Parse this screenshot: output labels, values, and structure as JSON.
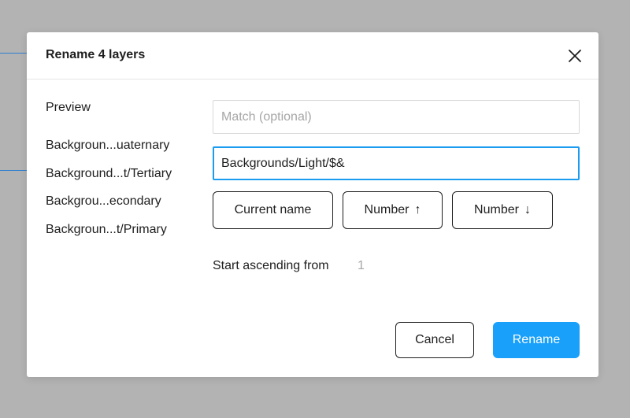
{
  "dialog": {
    "title": "Rename 4 layers",
    "close_icon": "close-icon"
  },
  "preview": {
    "label": "Preview",
    "items": [
      "Backgroun...uaternary",
      "Background...t/Tertiary",
      "Backgrou...econdary",
      "Backgroun...t/Primary"
    ]
  },
  "match_field": {
    "value": "",
    "placeholder": "Match (optional)"
  },
  "rename_field": {
    "value": "Backgrounds/Light/$&"
  },
  "chips": {
    "current_name": "Current name",
    "number_up": "Number",
    "number_up_arrow": "↑",
    "number_down": "Number",
    "number_down_arrow": "↓"
  },
  "start": {
    "label": "Start ascending from",
    "value": "1"
  },
  "footer": {
    "cancel_label": "Cancel",
    "rename_label": "Rename"
  },
  "colors": {
    "accent": "#18a0fb",
    "focus_border": "#1a9cf0",
    "backdrop": "#b3b3b3"
  }
}
